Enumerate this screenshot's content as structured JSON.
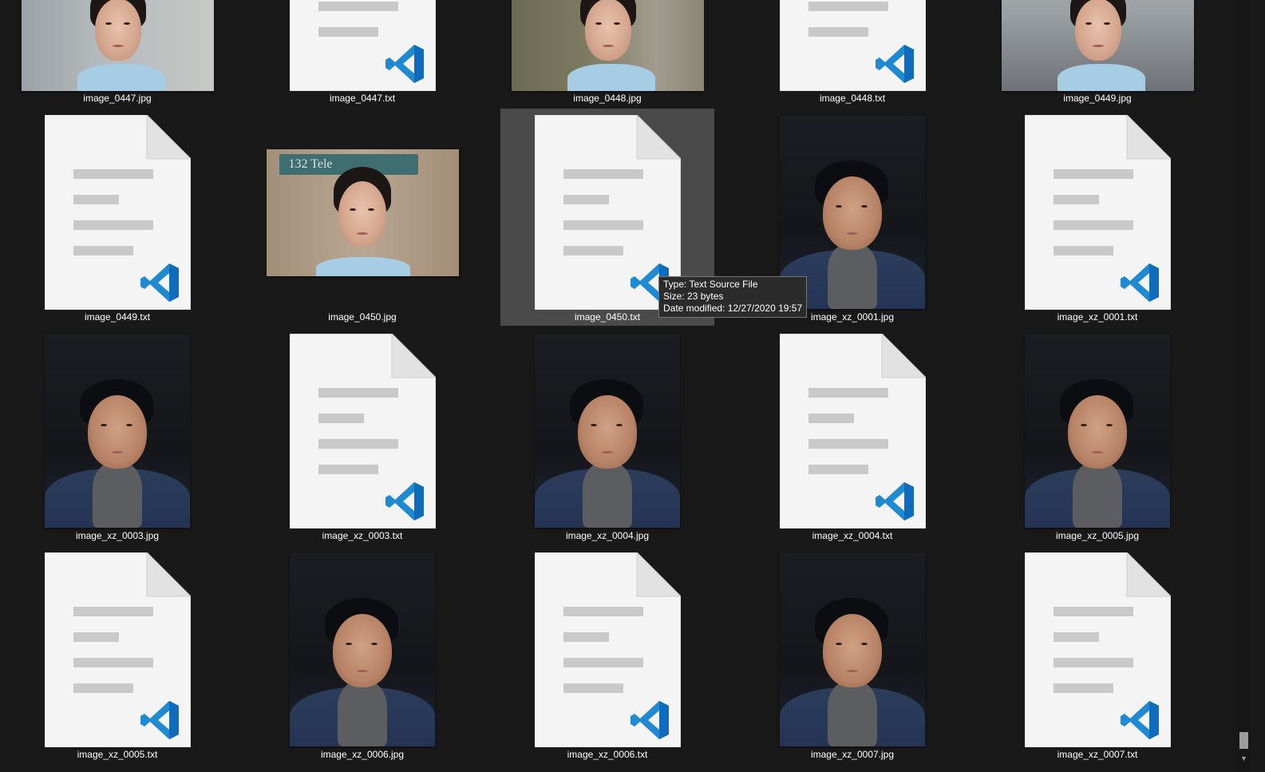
{
  "explorer": {
    "files": [
      {
        "name": "image_0447.jpg",
        "kind": "photo",
        "photo": "gray-portrait"
      },
      {
        "name": "image_0447.txt",
        "kind": "doc"
      },
      {
        "name": "image_0448.jpg",
        "kind": "photo",
        "photo": "office-portrait"
      },
      {
        "name": "image_0448.txt",
        "kind": "doc"
      },
      {
        "name": "image_0449.jpg",
        "kind": "photo",
        "photo": "desk-portrait"
      },
      {
        "name": "image_0449.txt",
        "kind": "doc"
      },
      {
        "name": "image_0450.jpg",
        "kind": "photo",
        "photo": "sign-portrait"
      },
      {
        "name": "image_0450.txt",
        "kind": "doc",
        "selected": true
      },
      {
        "name": "image_xz_0001.jpg",
        "kind": "photo",
        "photo": "dark-portrait"
      },
      {
        "name": "image_xz_0001.txt",
        "kind": "doc"
      },
      {
        "name": "image_xz_0003.jpg",
        "kind": "photo",
        "photo": "dark-portrait"
      },
      {
        "name": "image_xz_0003.txt",
        "kind": "doc"
      },
      {
        "name": "image_xz_0004.jpg",
        "kind": "photo",
        "photo": "dark-portrait"
      },
      {
        "name": "image_xz_0004.txt",
        "kind": "doc"
      },
      {
        "name": "image_xz_0005.jpg",
        "kind": "photo",
        "photo": "dark-portrait"
      },
      {
        "name": "image_xz_0005.txt",
        "kind": "doc"
      },
      {
        "name": "image_xz_0006.jpg",
        "kind": "photo",
        "photo": "dark-portrait"
      },
      {
        "name": "image_xz_0006.txt",
        "kind": "doc"
      },
      {
        "name": "image_xz_0007.jpg",
        "kind": "photo",
        "photo": "dark-portrait"
      },
      {
        "name": "image_xz_0007.txt",
        "kind": "doc"
      }
    ],
    "sign_text": "132 Tele",
    "doc_icon": "vscode-text-file-icon",
    "accent_color": "#1f8ad2"
  },
  "tooltip": {
    "type_line": "Type: Text Source File",
    "size_line": "Size: 23 bytes",
    "date_line": "Date modified: 12/27/2020 19:57"
  },
  "scrollbar": {
    "down_arrow": "▼"
  }
}
